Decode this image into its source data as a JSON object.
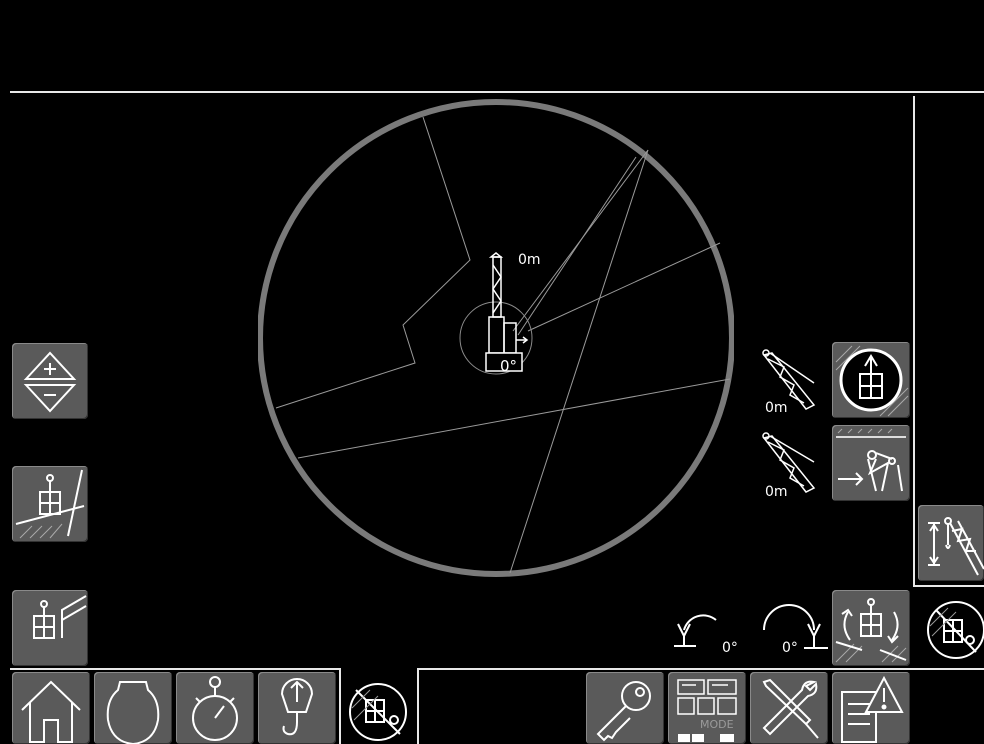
{
  "top_bar": {},
  "map": {
    "center_height": "0m",
    "center_slew": "0°"
  },
  "boom_indicators": {
    "upper_length": "0m",
    "lower_length": "0m"
  },
  "rotation": {
    "left_angle": "0°",
    "right_angle": "0°"
  },
  "icons": {
    "zoom": "zoom-in-out-icon",
    "slope": "crane-on-slope-icon",
    "wall": "crane-near-wall-icon",
    "crane_top_view": "crane-top-view-icon",
    "working_range": "working-range-icon",
    "hook_height": "hook-height-icon",
    "slew_limit": "slew-limit-icon",
    "disabled_crane": "crane-disabled-icon",
    "home": "home-icon",
    "blank_shape": "blank-shape-icon",
    "timer": "stopwatch-icon",
    "hook": "hook-icon",
    "key": "key-icon",
    "mode": "mode-icon",
    "tools": "tools-icon",
    "warning_doc": "warning-log-icon"
  },
  "mode_label": "MODE"
}
